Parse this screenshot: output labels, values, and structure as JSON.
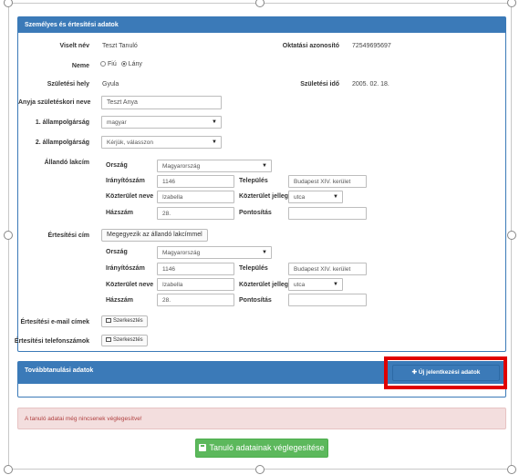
{
  "personal": {
    "title": "Személyes és értesítési adatok",
    "name_label": "Viselt név",
    "name_value": "Teszt Tanuló",
    "id_label": "Oktatási azonosító",
    "id_value": "72549695697",
    "sex_label": "Neme",
    "sex_male": "Fiú",
    "sex_female": "Lány",
    "birthplace_label": "Születési hely",
    "birthplace_value": "Gyula",
    "birthdate_label": "Születési idő",
    "birthdate_value": "2005. 02. 18.",
    "mother_label": "Anyja születéskori neve",
    "mother_value": "Teszt Anya",
    "nat1_label": "1. állampolgárság",
    "nat1_value": "magyar",
    "nat2_label": "2. állampolgárság",
    "nat2_value": "Kérjük, válasszon"
  },
  "permanent": {
    "title": "Állandó lakcím",
    "country_label": "Ország",
    "country_value": "Magyarország",
    "zip_label": "Irányítószám",
    "zip_value": "1146",
    "city_label": "Település",
    "city_value": "Budapest XIV. kerület",
    "street_label": "Közterület neve",
    "street_value": "Izabella",
    "street_type_label": "Közterület jellege",
    "street_type_value": "utca",
    "house_label": "Házszám",
    "house_value": "28.",
    "detail_label": "Pontosítás",
    "detail_value": ""
  },
  "notify": {
    "title": "Értesítési cím",
    "same_button": "Megegyezik az állandó lakcímmel",
    "country_label": "Ország",
    "country_value": "Magyarország",
    "zip_label": "Irányítószám",
    "zip_value": "1146",
    "city_label": "Település",
    "city_value": "Budapest XIV. kerület",
    "street_label": "Közterület neve",
    "street_value": "Izabella",
    "street_type_label": "Közterület jellege",
    "street_type_value": "utca",
    "house_label": "Házszám",
    "house_value": "28.",
    "detail_label": "Pontosítás",
    "detail_value": "",
    "email_label": "Értesítési e-mail címek",
    "email_button": "Szerkesztés",
    "phone_label": "Értesítési telefonszámok",
    "phone_button": "Szerkesztés"
  },
  "further": {
    "title": "Továbbtanulási adatok",
    "new_button": "Új jelentkezési adatok"
  },
  "alert": {
    "text": "A tanuló adatai még nincsenek véglegesítve!"
  },
  "finalize": {
    "label": "Tanuló adatainak véglegesítése"
  },
  "colors": {
    "primary": "#3b7ab8",
    "success": "#5cb85c",
    "danger_bg": "#f3dede",
    "highlight": "#e00000"
  }
}
